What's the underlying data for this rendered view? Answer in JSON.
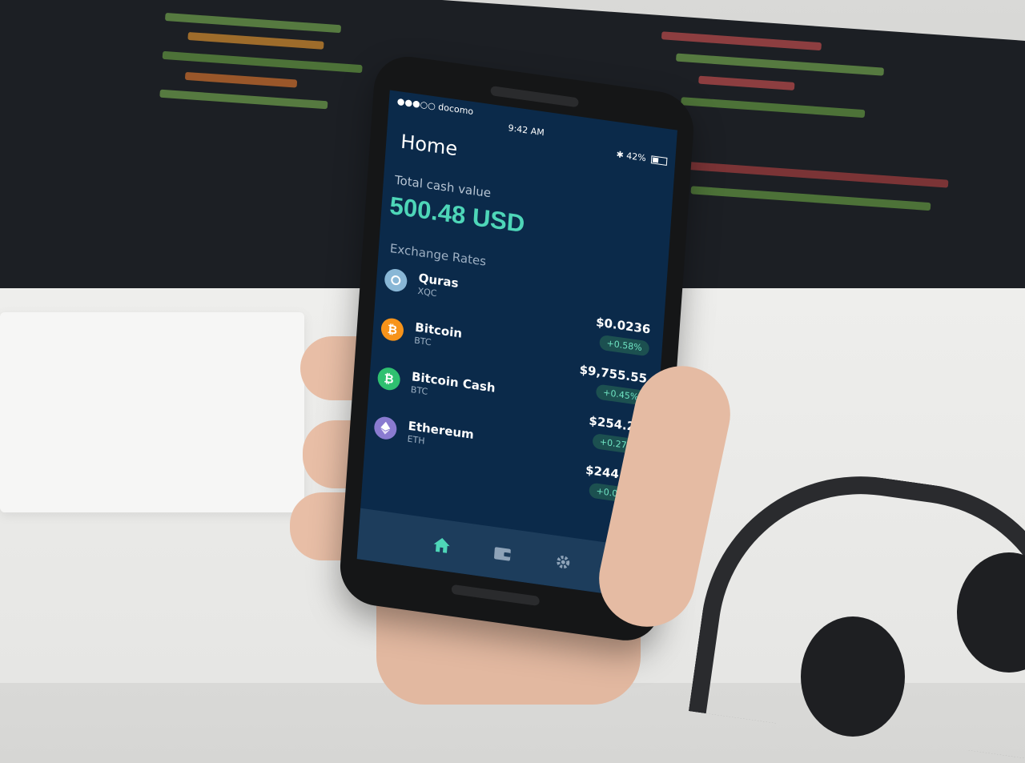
{
  "status_bar": {
    "carrier": "●●●○○ docomo",
    "time": "9:42 AM",
    "battery": "42%"
  },
  "header": {
    "title": "Home"
  },
  "balance": {
    "label": "Total cash value",
    "value": "500.48 USD"
  },
  "rates": {
    "label": "Exchange Rates",
    "items": [
      {
        "name": "Quras",
        "symbol": "XQC",
        "price": "$0.0236",
        "change": "+0.58%",
        "icon": "quras-icon",
        "color": "#89b7d6"
      },
      {
        "name": "Bitcoin",
        "symbol": "BTC",
        "price": "$9,755.55",
        "change": "+0.45%",
        "icon": "bitcoin-icon",
        "color": "#f7931a"
      },
      {
        "name": "Bitcoin Cash",
        "symbol": "BTC",
        "price": "$254.23",
        "change": "+0.27%",
        "icon": "bitcoin-cash-icon",
        "color": "#2fc070"
      },
      {
        "name": "Ethereum",
        "symbol": "ETH",
        "price": "$244.00",
        "change": "+0.01%",
        "icon": "ethereum-icon",
        "color": "#8a7bd0"
      }
    ]
  },
  "tabbar": {
    "tabs": [
      {
        "icon": "home-icon",
        "active": true
      },
      {
        "icon": "wallet-icon",
        "active": false
      },
      {
        "icon": "gear-icon",
        "active": false
      }
    ]
  },
  "colors": {
    "screen_bg": "#0b2a4a",
    "accent": "#4ed6b8",
    "tabbar_bg": "#1d3d5c"
  }
}
